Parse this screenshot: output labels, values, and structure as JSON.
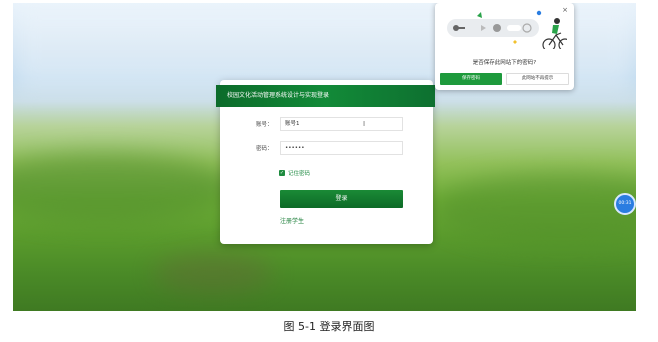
{
  "login": {
    "title": "校园文化活动管理系统设计与实现登录",
    "account_label": "账号：",
    "account_value": "账号1",
    "password_label": "密码：",
    "password_value": "••••••",
    "remember_label": "记住密码",
    "login_button": "登录",
    "register_link": "注册学生"
  },
  "password_prompt": {
    "question": "是否保存此网站下的密码?",
    "save_button": "保存密码",
    "never_button": "此网站不再提示",
    "close_glyph": "×"
  },
  "timer": {
    "text": "00:31"
  },
  "caption": "图 5-1 登录界面图",
  "colors": {
    "brand_green": "#128a38",
    "accent_blue": "#2a7de1"
  }
}
